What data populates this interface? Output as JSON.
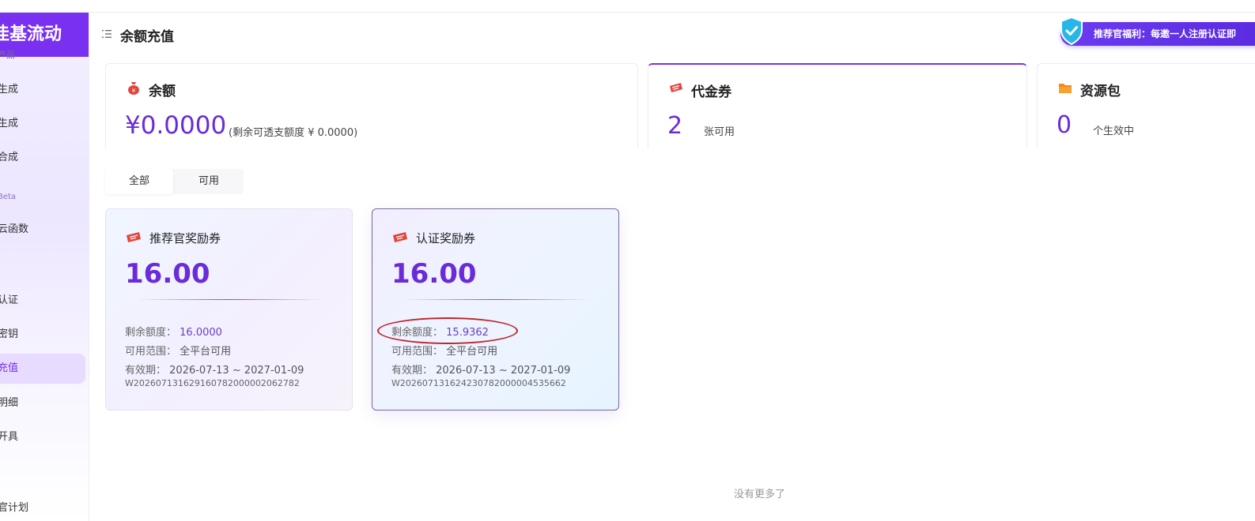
{
  "sidebar": {
    "brand": "佳基流动",
    "items": [
      {
        "label": "产品"
      },
      {
        "label": "生成"
      },
      {
        "label": "生成"
      },
      {
        "label": "合成"
      },
      {
        "label": "Beta"
      },
      {
        "label": "云函数"
      },
      {
        "label": "认证"
      },
      {
        "label": "密钥"
      },
      {
        "label": "充值"
      },
      {
        "label": "明细"
      },
      {
        "label": "开具"
      },
      {
        "label": "官计划"
      }
    ]
  },
  "header": {
    "title": "余额充值",
    "promo": "推荐官福利：每邀一人注册认证即"
  },
  "summary": {
    "balance": {
      "title": "余额",
      "amount": "¥0.0000",
      "note": "(剩余可透支额度 ¥ 0.0000)"
    },
    "voucher": {
      "title": "代金券",
      "count": "2",
      "note": "张可用"
    },
    "package": {
      "title": "资源包",
      "count": "0",
      "note": "个生效中"
    }
  },
  "tabs": [
    {
      "label": "全部"
    },
    {
      "label": "可用"
    }
  ],
  "coupons": [
    {
      "title": "推荐官奖励券",
      "amount": "16.00",
      "remaining_label": "剩余额度：",
      "remaining": "16.0000",
      "scope_label": "可用范围：",
      "scope": "全平台可用",
      "validity_label": "有效期：",
      "validity": "2026-07-13 ~ 2027-01-09",
      "code": "W20260713162916078200000206278​2"
    },
    {
      "title": "认证奖励券",
      "amount": "16.00",
      "remaining_label": "剩余额度：",
      "remaining": "15.9362",
      "scope_label": "可用范围：",
      "scope": "全平台可用",
      "validity_label": "有效期：",
      "validity": "2026-07-13 ~ 2027-01-09",
      "code": "W20260713162423078200000453566​2"
    }
  ],
  "footer": {
    "no_more": "没有更多了"
  },
  "colors": {
    "accent": "#7a30f0",
    "amount": "#6a2bd9",
    "annotation": "#c0242c"
  },
  "icons": {
    "balance": "money-bag-icon",
    "voucher": "ticket-icon",
    "package": "folder-icon",
    "menu": "menu-collapse-icon",
    "promo": "shield-check-icon"
  }
}
